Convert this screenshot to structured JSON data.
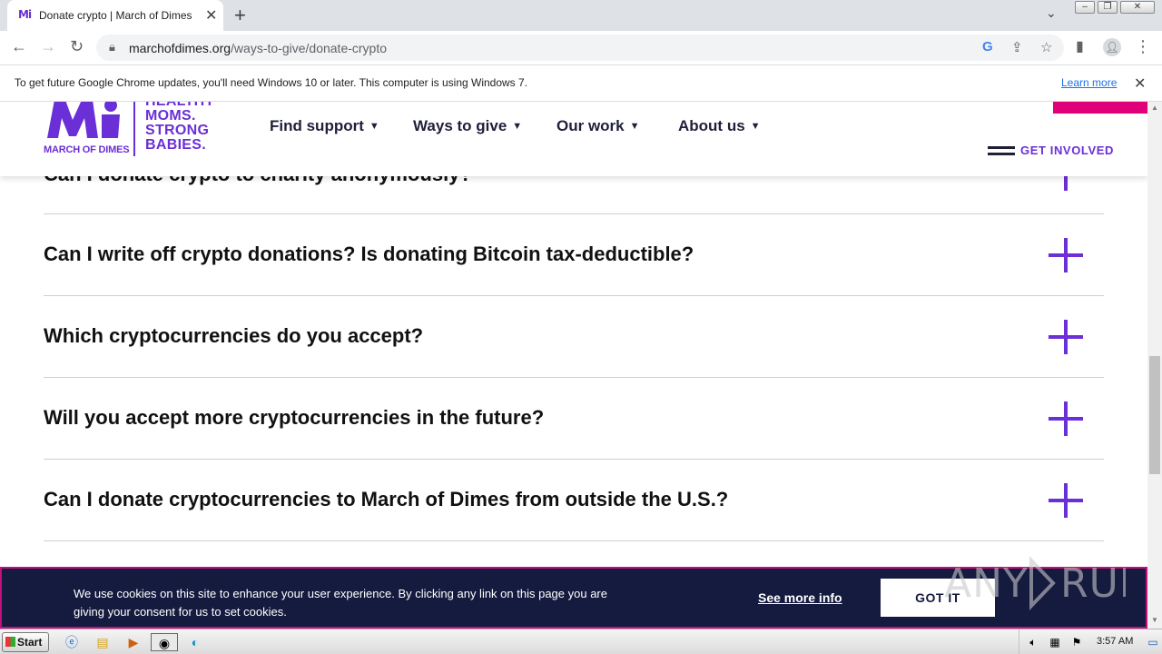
{
  "browser": {
    "tab_title": "Donate crypto | March of Dimes",
    "tab_favicon": "Mi",
    "url_domain": "marchofdimes.org",
    "url_path": "/ways-to-give/donate-crypto",
    "infobar_message": "To get future Google Chrome updates, you'll need Windows 10 or later. This computer is using Windows 7.",
    "infobar_link": "Learn more"
  },
  "site": {
    "brand": "MARCH OF DIMES",
    "tagline": [
      "HEALTHY",
      "MOMS.",
      "STRONG",
      "BABIES."
    ],
    "nav": [
      "Find support",
      "Ways to give",
      "Our work",
      "About us"
    ],
    "get_involved": "GET INVOLVED",
    "brand_color": "#6a2fd6",
    "accent_color": "#e0007a"
  },
  "faq": {
    "partial_question": "Can I donate crypto to charity anonymously?",
    "questions": [
      "Can I write off crypto donations? Is donating Bitcoin tax-deductible?",
      "Which cryptocurrencies do you accept?",
      "Will you accept more cryptocurrencies in the future?",
      "Can I donate cryptocurrencies to March of Dimes from outside the U.S.?"
    ]
  },
  "cookie": {
    "text": "We use cookies on this site to enhance your user experience. By clicking any link on this page you are giving your consent for us to set cookies.",
    "more_info": "See more info",
    "accept": "GOT IT"
  },
  "watermark": "ANY.RUN",
  "taskbar": {
    "start": "Start",
    "clock": "3:57 AM"
  }
}
